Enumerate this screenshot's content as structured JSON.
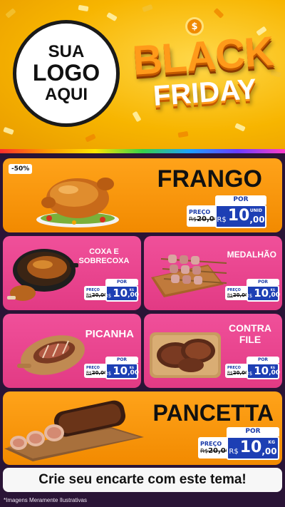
{
  "header": {
    "logo_line1": "SUA",
    "logo_line2": "LOGO",
    "logo_line3": "AQUI",
    "title_line1": "BLACK",
    "title_line2": "FRIDAY",
    "coin_symbol": "$"
  },
  "products": [
    {
      "name": "FRANGO",
      "badge": "-50%",
      "price_label": "PREÇO",
      "old_currency": "R$",
      "old_price": "20,00",
      "per_label": "POR",
      "currency": "R$",
      "price_int": "10",
      "price_cents": ",00",
      "unit": "UNID",
      "icon": "roast-chicken-icon"
    },
    {
      "name_line1": "COXA E",
      "name_line2": "SOBRECOXA",
      "price_label": "PREÇO",
      "old_currency": "R$",
      "old_price": "20,00",
      "per_label": "POR",
      "currency": "R$",
      "price_int": "10",
      "price_cents": ",00",
      "unit": "KG",
      "icon": "chicken-thigh-pan-icon"
    },
    {
      "name": "MEDALHÃO",
      "price_label": "PREÇO",
      "old_currency": "R$",
      "old_price": "20,00",
      "per_label": "POR",
      "currency": "R$",
      "price_int": "10",
      "price_cents": ",00",
      "unit": "KG",
      "icon": "medallion-skewers-icon"
    },
    {
      "name": "PICANHA",
      "price_label": "PREÇO",
      "old_currency": "R$",
      "old_price": "20,00",
      "per_label": "POR",
      "currency": "R$",
      "price_int": "10",
      "price_cents": ",00",
      "unit": "KG",
      "icon": "picanha-board-icon"
    },
    {
      "name_line1": "CONTRA",
      "name_line2": "FILE",
      "price_label": "PREÇO",
      "old_currency": "R$",
      "old_price": "20,00",
      "per_label": "POR",
      "currency": "R$",
      "price_int": "10",
      "price_cents": ",00",
      "unit": "KG",
      "icon": "steak-board-icon"
    },
    {
      "name": "PANCETTA",
      "price_label": "PREÇO",
      "old_currency": "R$",
      "old_price": "20,00",
      "per_label": "POR",
      "currency": "R$",
      "price_int": "10",
      "price_cents": ",00",
      "unit": "KG",
      "icon": "pancetta-board-icon"
    }
  ],
  "cta": "Crie seu encarte com este tema!",
  "disclaimer": "*Imagens Meramente Ilustrativas",
  "colors": {
    "header_yellow": "#f7b500",
    "panel_orange": "#f28a00",
    "panel_pink": "#e23a84",
    "price_blue": "#1d3fb4",
    "background": "#2a1436"
  }
}
